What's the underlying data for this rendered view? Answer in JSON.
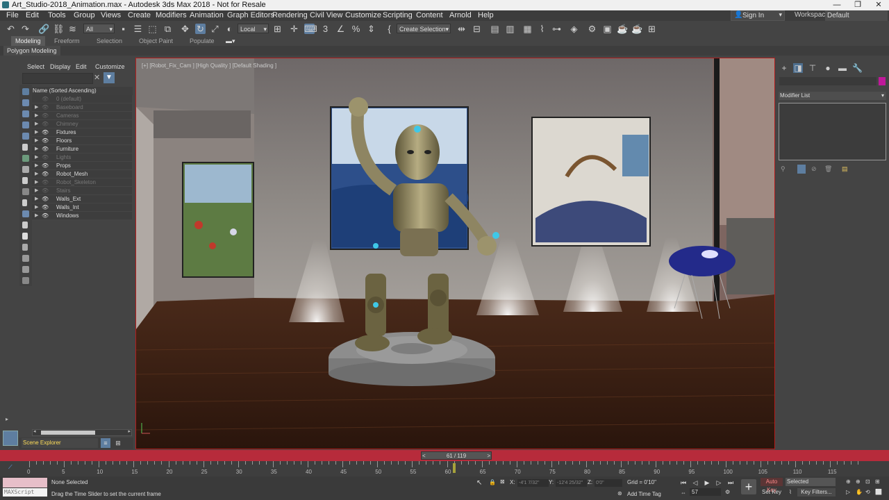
{
  "window": {
    "title": "Art_Studio-2018_Animation.max - Autodesk 3ds Max 2018 - Not for Resale",
    "controls": [
      "—",
      "❐",
      "✕"
    ]
  },
  "menu": {
    "items": [
      "File",
      "Edit",
      "Tools",
      "Group",
      "Views",
      "Create",
      "Modifiers",
      "Animation",
      "Graph Editors",
      "Rendering",
      "Civil View",
      "Customize",
      "Scripting",
      "Content",
      "Arnold",
      "Help"
    ],
    "sign_in": "Sign In",
    "workspaces_label": "Workspaces:",
    "workspaces_value": "Default"
  },
  "toolbar": {
    "selection_filter": "All",
    "reference_coord": "Local",
    "named_selection": "Create Selection Se",
    "snap_label": "3"
  },
  "ribbon": {
    "tabs": [
      "Modeling",
      "Freeform",
      "Selection",
      "Object Paint",
      "Populate"
    ],
    "active_tab": "Modeling",
    "sub_label": "Polygon Modeling"
  },
  "scene_explorer": {
    "menu": [
      "Select",
      "Display",
      "Edit",
      "Customize"
    ],
    "column_header": "Name (Sorted Ascending)",
    "rows": [
      {
        "name": "0 (default)",
        "dim": true
      },
      {
        "name": "Baseboard",
        "dim": true
      },
      {
        "name": "Cameras",
        "dim": true
      },
      {
        "name": "Chimney",
        "dim": true
      },
      {
        "name": "Fixtures",
        "dim": false
      },
      {
        "name": "Floors",
        "dim": false
      },
      {
        "name": "Furniture",
        "dim": false
      },
      {
        "name": "Lights",
        "dim": true
      },
      {
        "name": "Props",
        "dim": false
      },
      {
        "name": "Robot_Mesh",
        "dim": false
      },
      {
        "name": "Robot_Skeleton",
        "dim": true
      },
      {
        "name": "Stairs",
        "dim": true
      },
      {
        "name": "Walls_Ext",
        "dim": false
      },
      {
        "name": "Walls_Int",
        "dim": false
      },
      {
        "name": "Windows",
        "dim": false
      }
    ],
    "footer_dropdown": "Scene Explorer"
  },
  "viewport": {
    "label": "[+] [Robot_Fix_Cam ] [High Quality ] [Default Shading ]"
  },
  "command_panel": {
    "modifier_list": "Modifier List",
    "object_color": "#c0189a"
  },
  "timeline": {
    "frame_display": "61 / 119",
    "current_frame": 61,
    "total_frames": 119,
    "ticks": [
      "0",
      "5",
      "10",
      "15",
      "20",
      "25",
      "30",
      "35",
      "40",
      "45",
      "50",
      "55",
      "60",
      "65",
      "70",
      "75",
      "80",
      "85",
      "90",
      "95",
      "100",
      "105",
      "110",
      "115"
    ]
  },
  "status": {
    "maxscript": "MAXScript Mi:",
    "selection": "None Selected",
    "prompt": "Drag the Time Slider to set the current frame",
    "x_label": "X:",
    "x_value": "-4'1 7/32\"",
    "y_label": "Y:",
    "y_value": "-12'4 25/32\"",
    "z_label": "Z:",
    "z_value": "0'0\"",
    "grid": "Grid = 0'10\"",
    "add_time_tag": "Add Time Tag",
    "frame_input": "57",
    "auto_key": "Auto Key",
    "set_key": "Set Key",
    "key_mode": "Selected",
    "key_filters": "Key Filters..."
  },
  "colors": {
    "accent": "#5e7ea0",
    "viewport_border": "#b41c1c",
    "timebar": "#b72b3b",
    "auto_key": "#ff8a8a"
  }
}
